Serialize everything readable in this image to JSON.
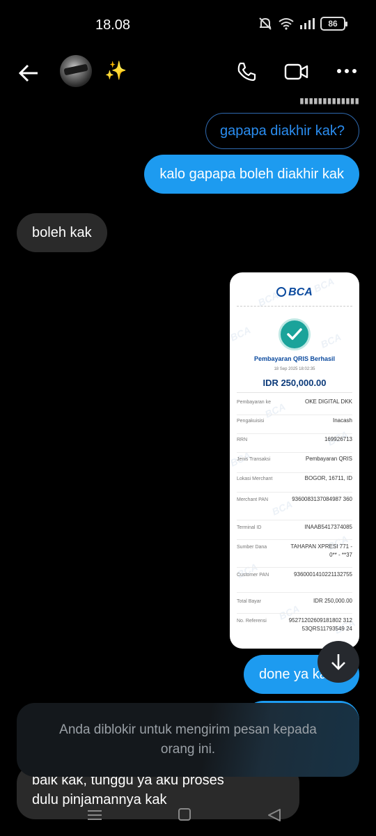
{
  "status_bar": {
    "time": "18.08",
    "battery": "86"
  },
  "header": {
    "back_icon": "arrow-left-icon",
    "title_emoji": "✨",
    "call_icon": "phone-icon",
    "video_icon": "video-camera-icon",
    "more_icon": "more-horizontal-icon"
  },
  "messages": {
    "reply_preview": "gapapa diakhir kak?",
    "msg1": "kalo gapapa boleh diakhir kak",
    "msg2": "boleh kak",
    "msg3": "done ya kak",
    "msg5_line1": "baik kak, tunggu ya aku proses",
    "msg5_line2": "dulu pinjamannya kak"
  },
  "receipt": {
    "bank": "BCA",
    "title": "Pembayaran QRIS Berhasil",
    "date": "18 Sep 2025 18:02:35",
    "amount": "IDR 250,000.00",
    "rows": [
      {
        "label": "Pembayaran ke",
        "value": "OKE DIGITAL DKK"
      },
      {
        "label": "Pengakuisisi",
        "value": "Inacash"
      },
      {
        "label": "RRN",
        "value": "169926713"
      },
      {
        "label": "Jenis Transaksi",
        "value": "Pembayaran QRIS"
      },
      {
        "label": "Lokasi Merchant",
        "value": "BOGOR, 16711, ID"
      },
      {
        "label": "Merchant PAN",
        "value": "9360083137084987 360"
      },
      {
        "label": "Terminal ID",
        "value": "INAAB5417374085"
      },
      {
        "label": "Sumber Dana",
        "value": "TAHAPAN XPRESI 771 - 0** - **37"
      },
      {
        "label": "Customer PAN",
        "value": "9360001410221132755"
      },
      {
        "label": "Total Bayar",
        "value": "IDR 250,000.00"
      },
      {
        "label": "No. Referensi",
        "value": "95271202609181802 31253QRS11793549 24"
      }
    ]
  },
  "toast": {
    "text": "Anda diblokir untuk mengirim pesan kepada orang ini."
  },
  "scroll_button_icon": "arrow-down-icon",
  "nav": {
    "menu_icon": "menu-icon",
    "home_icon": "home-square-icon",
    "back_icon": "back-triangle-icon"
  }
}
